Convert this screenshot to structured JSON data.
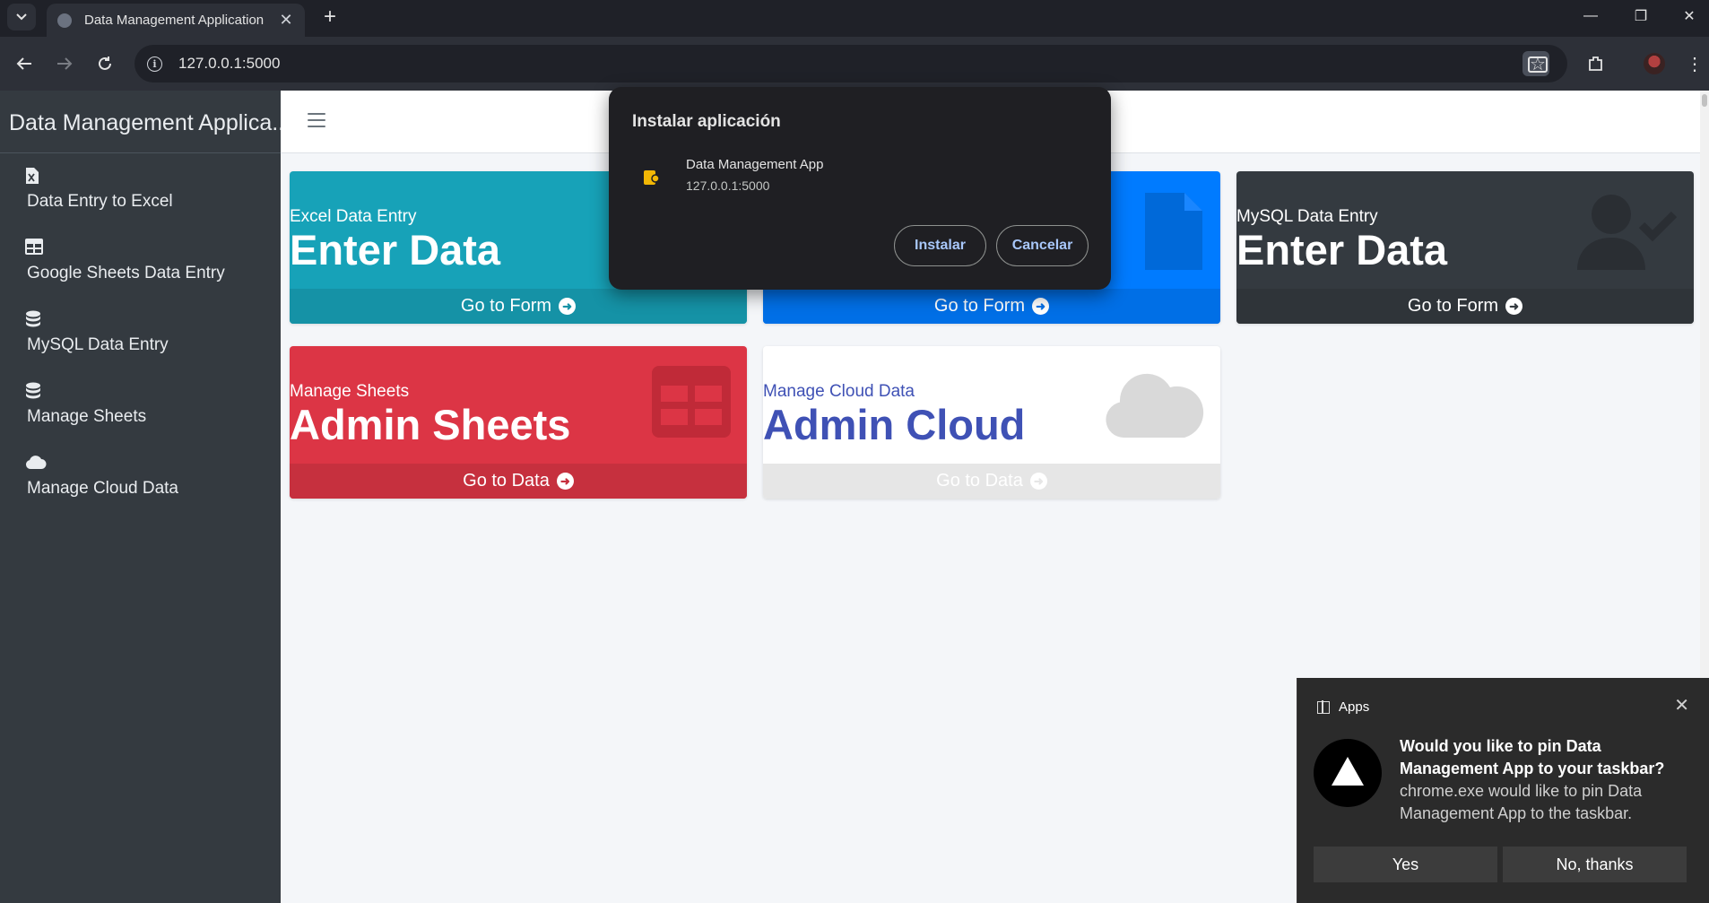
{
  "browser": {
    "tab_title": "Data Management Application",
    "url": "127.0.0.1:5000"
  },
  "sidebar": {
    "brand": "Data Management Applica..",
    "items": [
      {
        "label": "Data Entry to Excel",
        "icon": "file-excel-icon"
      },
      {
        "label": "Google Sheets Data Entry",
        "icon": "table-icon"
      },
      {
        "label": "MySQL Data Entry",
        "icon": "database-icon"
      },
      {
        "label": "Manage Sheets",
        "icon": "database-icon"
      },
      {
        "label": "Manage Cloud Data",
        "icon": "cloud-icon"
      }
    ]
  },
  "cards": [
    {
      "subtitle": "Excel Data Entry",
      "headline": "Enter Data",
      "footer": "Go to Form",
      "color": "#17a2b8"
    },
    {
      "subtitle": "",
      "headline": "",
      "footer": "Go to Form",
      "color": "#007bff"
    },
    {
      "subtitle": "MySQL Data Entry",
      "headline": "Enter Data",
      "footer": "Go to Form",
      "color": "#343a40"
    },
    {
      "subtitle": "Manage Sheets",
      "headline": "Admin Sheets",
      "footer": "Go to Data",
      "color": "#dc3545"
    },
    {
      "subtitle": "Manage Cloud Data",
      "headline": "Admin Cloud",
      "footer": "Go to Data",
      "color": "#ffffff"
    }
  ],
  "install_dialog": {
    "title": "Instalar aplicación",
    "app_name": "Data Management App",
    "app_url": "127.0.0.1:5000",
    "install_label": "Instalar",
    "cancel_label": "Cancelar"
  },
  "toast": {
    "app_label": "Apps",
    "heading": "Would you like to pin Data Management App to your taskbar?",
    "body": "chrome.exe would like to pin Data Management App to the taskbar.",
    "yes_label": "Yes",
    "no_label": "No, thanks"
  }
}
